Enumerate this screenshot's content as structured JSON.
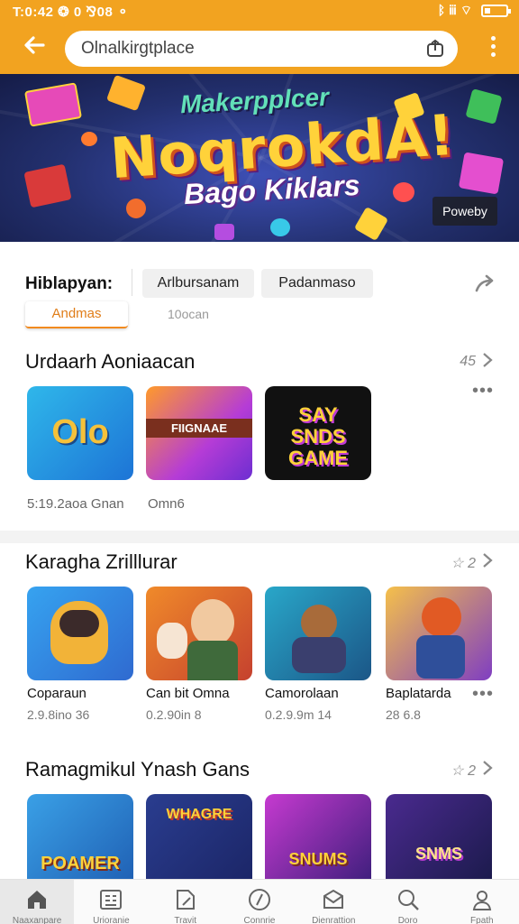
{
  "status": {
    "time": "T:0:42 ❂ 0 ⅋08 ⚬",
    "icons": "ᛒ ⅲ ⌔"
  },
  "header": {
    "search_text": "Olnalkirgtplace"
  },
  "banner": {
    "top_text": "Makerpplcer",
    "main_text": "NoqrokdA!",
    "sub_text": "Bago Kiklars",
    "chip_label": "Poweby"
  },
  "filters": {
    "title": "Hiblapyan:",
    "chips": [
      "Arlbursanam",
      "Padanmaso"
    ],
    "tabs": [
      "Andmas",
      "10ocan"
    ]
  },
  "sections": [
    {
      "title": "Urdaarh Aoniaacan",
      "meta": "45",
      "items": [
        {
          "name": "5:19.2aoa Gnan",
          "art": "Olo"
        },
        {
          "name": "Omn6",
          "art": "FIIGNAAE"
        },
        {
          "name": "",
          "art": "SAY SNDS GAME"
        }
      ]
    },
    {
      "title": "Karagha Zrilllurar",
      "meta": "2",
      "items": [
        {
          "name": "Coparaun",
          "meta": "2.9.8ino 36"
        },
        {
          "name": "Can bit Omna",
          "meta": "0.2.90in 8"
        },
        {
          "name": "Camorolaan",
          "meta": "0.2.9.9m 14"
        },
        {
          "name": "Baplatarda",
          "meta": "28 6.8"
        }
      ]
    },
    {
      "title": "Ramagmikul Ynash Gans",
      "meta": "2",
      "items": [
        {
          "art": "POAMER"
        },
        {
          "art": "WHAGRE"
        },
        {
          "art": "SNUMS"
        },
        {
          "art": "SNMS"
        }
      ]
    }
  ],
  "bottom_nav": [
    "Naaxanpare",
    "Urioranie",
    "Travit",
    "Connrie",
    "Dienrattion",
    "Doro",
    "Fpath"
  ],
  "colors": {
    "accent": "#f2a320",
    "tab_active": "#e07d18"
  }
}
